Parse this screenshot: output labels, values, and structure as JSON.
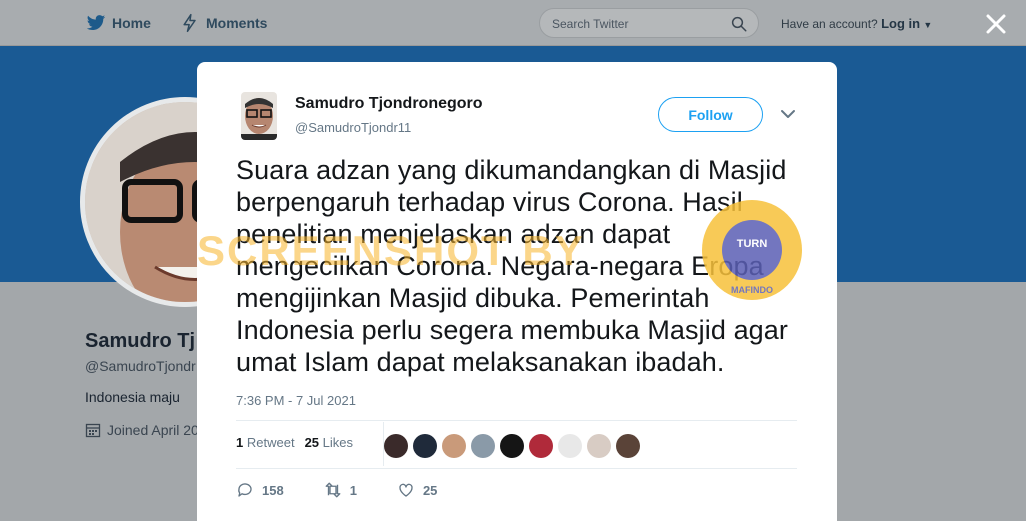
{
  "nav": {
    "home_label": "Home",
    "moments_label": "Moments",
    "search_placeholder": "Search Twitter",
    "account_prompt": "Have an account?",
    "login_label": "Log in"
  },
  "profile": {
    "name": "Samudro Tj",
    "handle": "@SamudroTjondr",
    "bio": "Indonesia maju",
    "joined": "Joined April 20"
  },
  "tweet": {
    "author_name": "Samudro Tjondronegoro",
    "author_handle": "@SamudroTjondr11",
    "follow_label": "Follow",
    "text": "Suara adzan yang dikumandangkan di Masjid berpengaruh terhadap virus Corona. Hasil penelitian menjelaskan adzan dapat mengecilkan Corona. Negara-negara Eropa mengijinkan Masjid dibuka. Pemerintah Indonesia perlu segera membuka Masjid agar umat Islam dapat melaksanakan ibadah.",
    "timestamp": "7:36 PM - 7 Jul 2021",
    "retweet_count": "1",
    "retweet_label": "Retweet",
    "like_count": "25",
    "like_label": "Likes",
    "reply_action_count": "158",
    "retweet_action_count": "1",
    "like_action_count": "25"
  },
  "overlay": {
    "watermark": "SCREENSHOT BY",
    "seal_top": "TURN",
    "seal_bottom": "MAFINDO"
  },
  "colors": {
    "brand_blue": "#1da1f2",
    "banner": "#1a5a94",
    "watermark": "#f7b529"
  }
}
